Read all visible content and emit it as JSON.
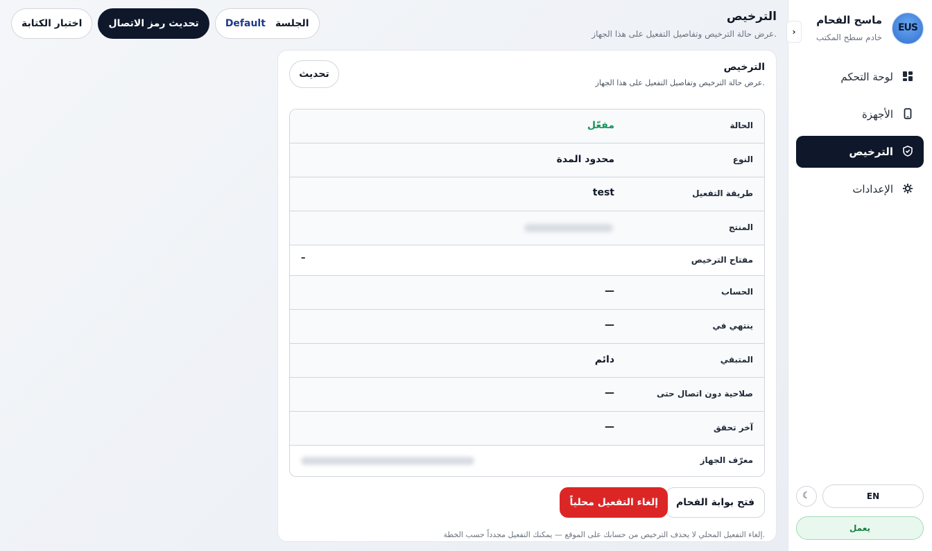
{
  "sidebar": {
    "brand": {
      "logo_text": "EUS",
      "name": "ماسح الفحام",
      "subtitle": "خادم سطح المكتب"
    },
    "collapse_glyph": "›",
    "items": [
      {
        "label": "لوحة التحكم",
        "icon": "dashboard-icon",
        "active": false
      },
      {
        "label": "الأجهزة",
        "icon": "device-icon",
        "active": false
      },
      {
        "label": "الترخيص",
        "icon": "shield-icon",
        "active": true
      },
      {
        "label": "الإعدادات",
        "icon": "gear-icon",
        "active": false
      }
    ],
    "language_button": "EN",
    "theme_glyph": "☾",
    "status": "يعمل"
  },
  "header": {
    "title": "الترخيص",
    "subtitle": "عرض حالة الترخيص وتفاصيل التفعيل على هذا الجهاز."
  },
  "top_actions": {
    "session_label": "الجلسة",
    "session_value": "Default",
    "refresh_token": "تحديث رمز الاتصال",
    "test_writing": "اختبار الكتابة"
  },
  "card": {
    "title": "الترخيص",
    "subtitle": "عرض حالة الترخيص وتفاصيل التفعيل على هذا الجهاز.",
    "refresh": "تحديث",
    "rows": [
      {
        "label": "الحالة",
        "value": "مفعّل"
      },
      {
        "label": "النوع",
        "value": "محدود المدة"
      },
      {
        "label": "طريقة التفعيل",
        "value": "test"
      },
      {
        "label": "المنتج",
        "value": ""
      },
      {
        "label": "مفتاح الترخيص",
        "value": "–"
      },
      {
        "label": "الحساب",
        "value": "—"
      },
      {
        "label": "ينتهي في",
        "value": "—"
      },
      {
        "label": "المتبقي",
        "value": "دائم"
      },
      {
        "label": "صلاحية دون اتصال حتى",
        "value": "—"
      },
      {
        "label": "آخر تحقق",
        "value": "—"
      },
      {
        "label": "معرّف الجهاز",
        "value": ""
      }
    ],
    "open_portal": "فتح بوابة الفحام",
    "deactivate": "إلغاء التفعيل محلياً",
    "footnote": "إلغاء التفعيل المحلي لا يحذف الترخيص من حسابك على الموقع — يمكنك التفعيل مجدداً حسب الخطة."
  },
  "colors": {
    "active_nav": "#0f172a",
    "danger": "#dc2626",
    "success": "#15965a",
    "session_value": "#1e3a8a"
  }
}
